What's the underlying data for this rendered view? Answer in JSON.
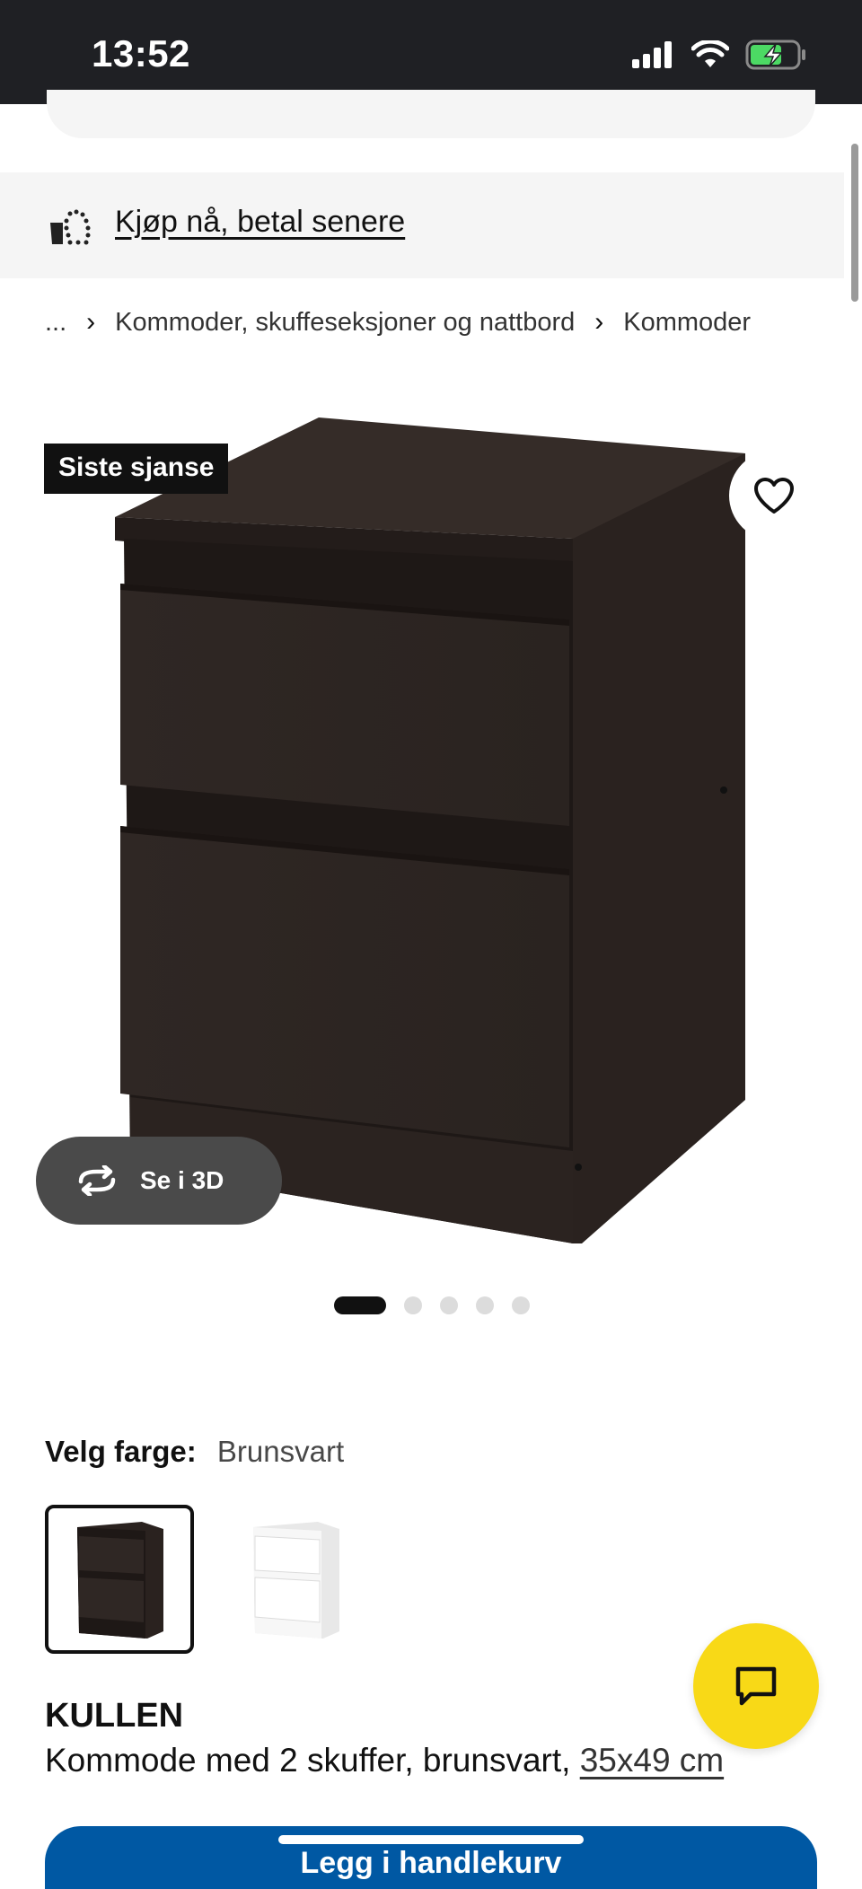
{
  "status_bar": {
    "time": "13:52"
  },
  "banner": {
    "bnpl_text": "Kjøp nå, betal senere"
  },
  "breadcrumb": {
    "ellipsis": "...",
    "items": [
      "Kommoder, skuffeseksjoner og nattbord",
      "Kommoder"
    ],
    "separator": "›"
  },
  "product": {
    "badge": "Siste sjanse",
    "see_3d": "Se i 3D",
    "carousel": {
      "total_images": 5,
      "active_index": 0
    },
    "color_label": "Velg farge:",
    "color_value": "Brunsvart",
    "colors": [
      {
        "name": "Brunsvart",
        "hex": "#2b2320",
        "selected": true
      },
      {
        "name": "Hvit",
        "hex": "#f4f4f4",
        "selected": false
      }
    ],
    "name": "KULLEN",
    "description": "Kommode med 2 skuffer, brunsvart, ",
    "size": "35x49 cm"
  },
  "cta": {
    "label": "Legg i handlekurv"
  },
  "theme": {
    "ikea_blue": "#0058a3",
    "ikea_yellow": "#f8d917",
    "product_color": "#2b2320"
  }
}
